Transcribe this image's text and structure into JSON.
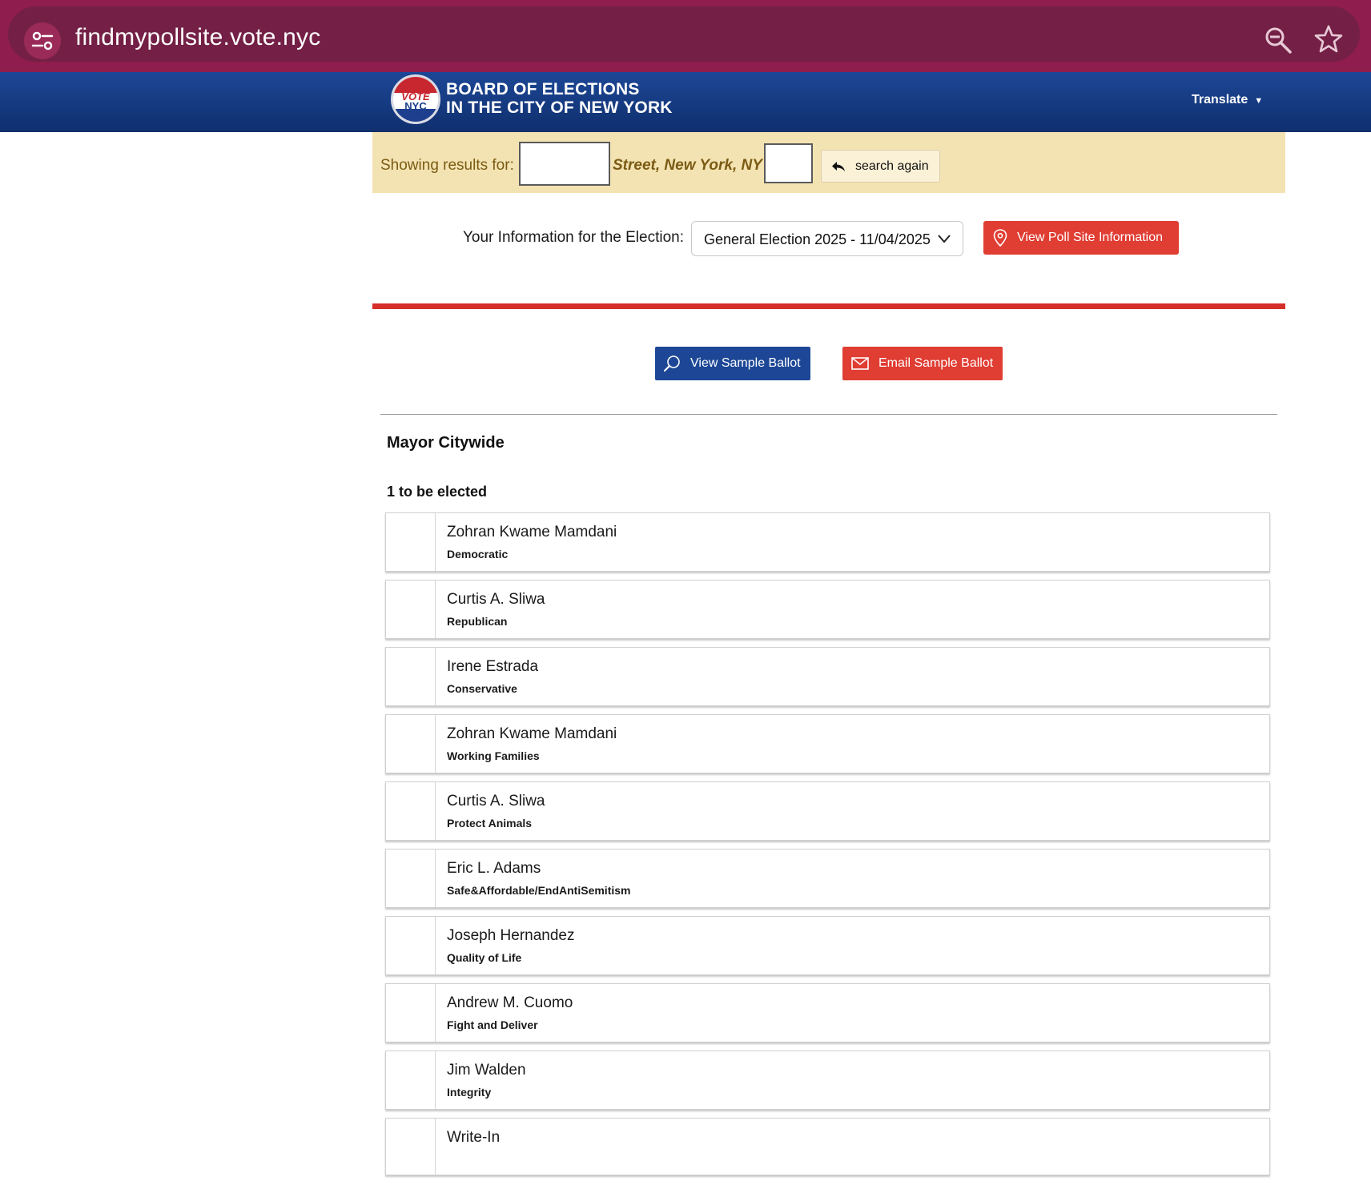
{
  "browser": {
    "url": "findmypollsite.vote.nyc"
  },
  "header": {
    "logo_vote": "VOTE",
    "logo_nyc": "NYC",
    "title_line1": "BOARD OF ELECTIONS",
    "title_line2": "IN THE CITY OF NEW YORK",
    "translate_label": "Translate"
  },
  "results": {
    "label": "Showing results for:",
    "street_text": "Street, New York, NY",
    "search_again_label": "search again"
  },
  "election": {
    "label": "Your Information for the Election:",
    "selected": "General Election 2025 - 11/04/2025",
    "poll_site_button": "View Poll Site Information"
  },
  "ballot_actions": {
    "view_label": "View Sample Ballot",
    "email_label": "Email Sample Ballot"
  },
  "contest": {
    "office": "Mayor Citywide",
    "vote_for": "1 to be elected",
    "candidates": [
      {
        "name": "Zohran Kwame Mamdani",
        "party": "Democratic"
      },
      {
        "name": "Curtis A. Sliwa",
        "party": "Republican"
      },
      {
        "name": "Irene Estrada",
        "party": "Conservative"
      },
      {
        "name": "Zohran Kwame Mamdani",
        "party": "Working Families"
      },
      {
        "name": "Curtis A. Sliwa",
        "party": "Protect Animals"
      },
      {
        "name": "Eric L. Adams",
        "party": "Safe&Affordable/EndAntiSemitism"
      },
      {
        "name": "Joseph Hernandez",
        "party": "Quality of Life"
      },
      {
        "name": "Andrew M. Cuomo",
        "party": "Fight and Deliver"
      },
      {
        "name": "Jim Walden",
        "party": "Integrity"
      },
      {
        "name": "Write-In",
        "party": ""
      }
    ]
  },
  "colors": {
    "browser_bar": "#8f1d4d",
    "header_blue": "#1d4796",
    "accent_red": "#e03d33",
    "results_bg": "#f4e3b2"
  },
  "icons": {
    "site_settings": "tune-icon",
    "zoom": "zoom-out-icon",
    "bookmark": "star-icon",
    "search_again": "reply-arrow-icon",
    "poll_site": "map-pin-icon",
    "view_ballot": "magnifier-icon",
    "email_ballot": "envelope-icon"
  }
}
